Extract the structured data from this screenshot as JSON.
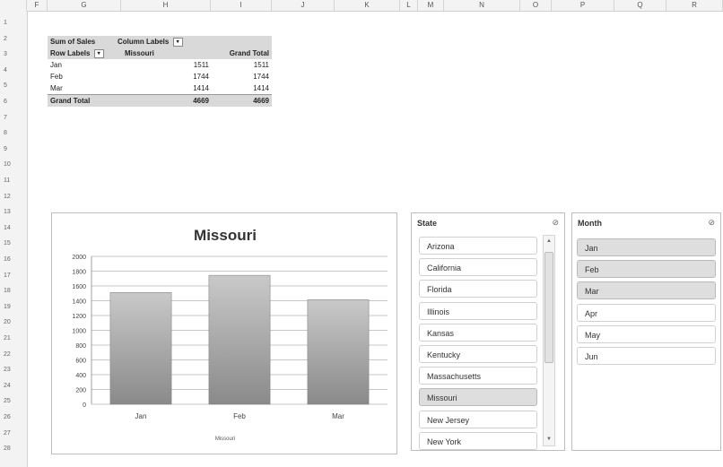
{
  "columns": [
    "",
    "F",
    "G",
    "H",
    "I",
    "J",
    "K",
    "L",
    "M",
    "N",
    "O",
    "P",
    "Q",
    "R"
  ],
  "rows": [
    "1",
    "2",
    "3",
    "4",
    "5",
    "6",
    "7",
    "8",
    "9",
    "10",
    "11",
    "12",
    "13",
    "14",
    "15",
    "16",
    "17",
    "18",
    "19",
    "20",
    "21",
    "22",
    "23",
    "24",
    "25",
    "26",
    "27",
    "28"
  ],
  "pivot": {
    "header1": {
      "a": "Sum of Sales",
      "b": "Column Labels"
    },
    "header2": {
      "a": "Row Labels",
      "b": "Missouri",
      "c": "Grand Total"
    },
    "rows": [
      {
        "label": "Jan",
        "v1": "1511",
        "v2": "1511"
      },
      {
        "label": "Feb",
        "v1": "1744",
        "v2": "1744"
      },
      {
        "label": "Mar",
        "v1": "1414",
        "v2": "1414"
      }
    ],
    "total": {
      "label": "Grand Total",
      "v1": "4669",
      "v2": "4669"
    }
  },
  "chart_data": {
    "type": "bar",
    "title": "Missouri",
    "categories": [
      "Jan",
      "Feb",
      "Mar"
    ],
    "series": [
      {
        "name": "Missouri",
        "values": [
          1511,
          1744,
          1414
        ]
      }
    ],
    "ylim": [
      0,
      2000
    ],
    "yticks": [
      0,
      200,
      400,
      600,
      800,
      1000,
      1200,
      1400,
      1600,
      1800,
      2000
    ],
    "grid": true,
    "legend": "bottom"
  },
  "slicer_state": {
    "title": "State",
    "items": [
      "Arizona",
      "California",
      "Florida",
      "Illinois",
      "Kansas",
      "Kentucky",
      "Massachusetts",
      "Missouri",
      "New Jersey",
      "New York"
    ],
    "selected": [
      "Missouri"
    ]
  },
  "slicer_month": {
    "title": "Month",
    "items": [
      "Jan",
      "Feb",
      "Mar",
      "Apr",
      "May",
      "Jun"
    ],
    "selected": [
      "Jan",
      "Feb",
      "Mar"
    ]
  },
  "icons": {
    "filter": "filter-icon",
    "clear_filter": "clear-filter-icon"
  },
  "colors": {
    "bar_top": "#c9c9c9",
    "bar_bottom": "#8a8a8a",
    "selected": "#dedede"
  }
}
